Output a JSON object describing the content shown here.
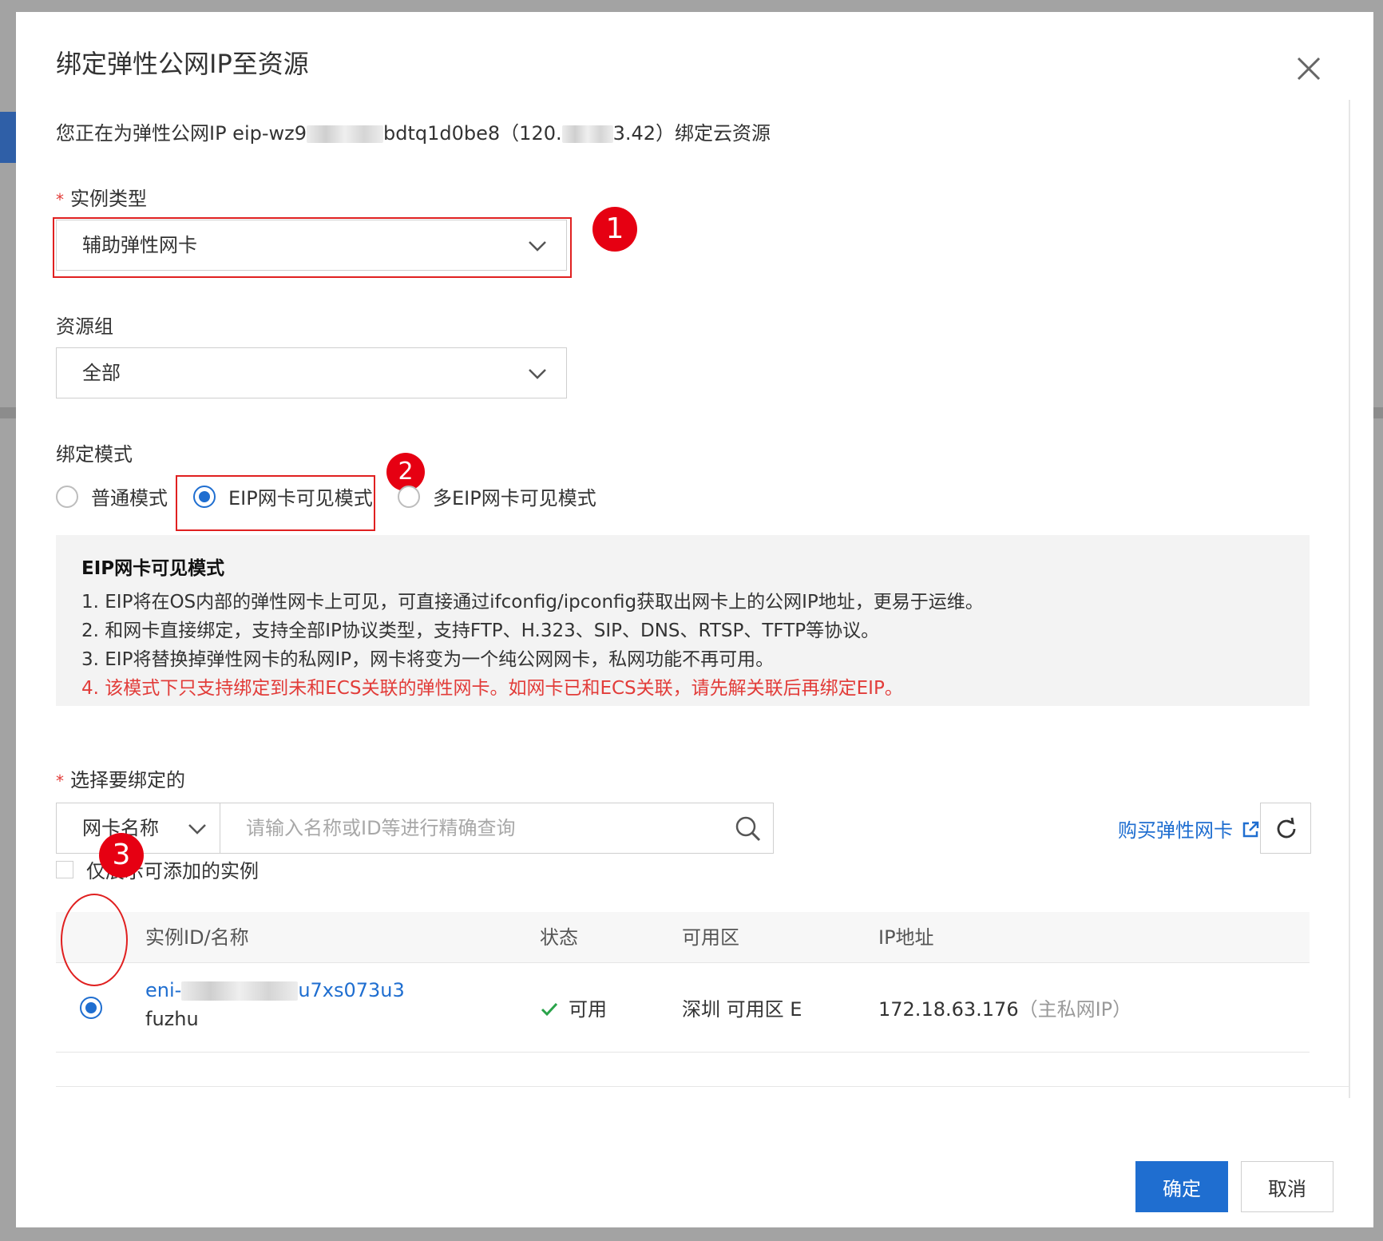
{
  "dialog": {
    "title": "绑定弹性公网IP至资源",
    "info_prefix": "您正在为弹性公网IP eip-wz9",
    "info_mid": "bdtq1d0be8（120.",
    "info_suffix": "3.42）绑定云资源"
  },
  "instance_type": {
    "label": "实例类型",
    "value": "辅助弹性网卡"
  },
  "resource_group": {
    "label": "资源组",
    "value": "全部"
  },
  "bind_mode": {
    "label": "绑定模式",
    "options": [
      {
        "label": "普通模式",
        "selected": false
      },
      {
        "label": "EIP网卡可见模式",
        "selected": true
      },
      {
        "label": "多EIP网卡可见模式",
        "selected": false
      }
    ]
  },
  "notice": {
    "title": "EIP网卡可见模式",
    "lines": [
      "1. EIP将在OS内部的弹性网卡上可见，可直接通过ifconfig/ipconfig获取出网卡上的公网IP地址，更易于运维。",
      "2. 和网卡直接绑定，支持全部IP协议类型，支持FTP、H.323、SIP、DNS、RTSP、TFTP等协议。",
      "3. EIP将替换掉弹性网卡的私网IP，网卡将变为一个纯公网网卡，私网功能不再可用。"
    ],
    "warning": "4. 该模式下只支持绑定到未和ECS关联的弹性网卡。如网卡已和ECS关联，请先解关联后再绑定EIP。"
  },
  "select_target": {
    "label": "选择要绑定的",
    "search_type": "网卡名称",
    "search_placeholder": "请输入名称或ID等进行精确查询",
    "buy_link": "购买弹性网卡",
    "only_addable": "仅展示可添加的实例"
  },
  "table": {
    "headers": [
      "实例ID/名称",
      "状态",
      "可用区",
      "IP地址"
    ],
    "rows": [
      {
        "id_prefix": "eni-",
        "id_suffix": "u7xs073u3",
        "name": "fuzhu",
        "status": "可用",
        "zone": "深圳 可用区 E",
        "ip": "172.18.63.176",
        "ip_note": "（主私网IP）",
        "selected": true
      }
    ]
  },
  "annotations": [
    "1",
    "2",
    "3"
  ],
  "footer": {
    "ok": "确定",
    "cancel": "取消"
  },
  "colors": {
    "primary": "#1f6ed0",
    "warning": "#e23c39",
    "annotation": "#e60012",
    "success": "#2aa34a"
  }
}
